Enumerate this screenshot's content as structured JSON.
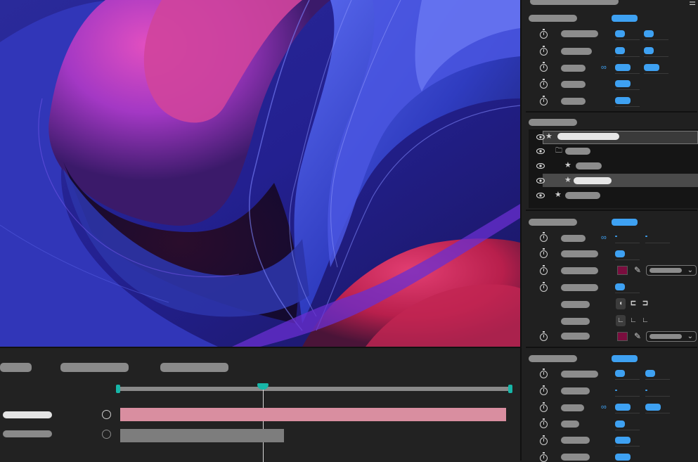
{
  "app": {
    "canvas": {
      "artwork": "abstract-wave-artwork",
      "colors": {
        "deep": "#1d1a78",
        "blue": "#3a40c8",
        "purple": "#7a38d6",
        "magenta": "#c83fb2",
        "pink": "#d83a78",
        "red": "#c01c46"
      }
    },
    "timeline": {
      "playhead_position": 0.37,
      "track_color": "#8a8a8a",
      "accent": "#17b6a8",
      "clips": [
        {
          "name": "clip-1",
          "start": 0.0,
          "end": 1.0,
          "color": "#d98ea0"
        },
        {
          "name": "clip-2",
          "start": 0.0,
          "end": 0.425,
          "color": "#7d7d7d"
        }
      ]
    },
    "panel": {
      "accent": "#3ea1f2",
      "swatch_color": "#7a0d3e",
      "icons": [
        "stopwatch-icon",
        "link-icon",
        "eye-icon",
        "star-icon",
        "folder-icon",
        "eyedropper-icon",
        "chevron-down-icon",
        "menu-icon"
      ]
    }
  }
}
